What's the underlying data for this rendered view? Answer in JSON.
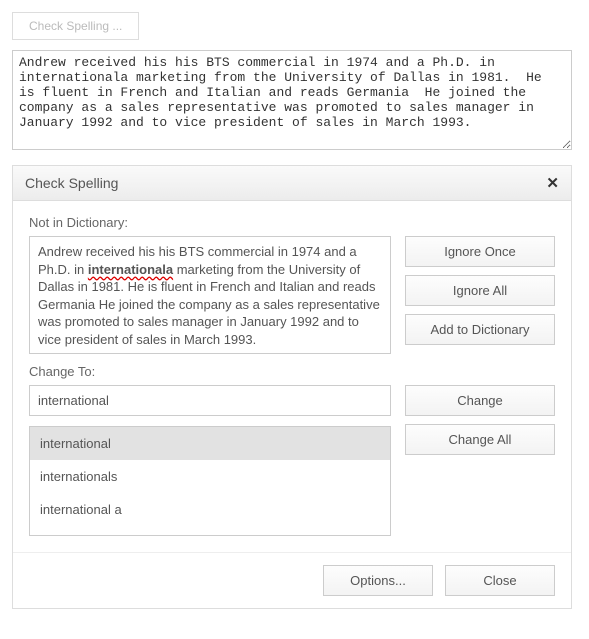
{
  "top_button": "Check Spelling ...",
  "textarea_value": "Andrew received his his BTS commercial in 1974 and a Ph.D. in internationala marketing from the University of Dallas in 1981.  He is fluent in French and Italian and reads Germania  He joined the company as a sales representative was promoted to sales manager in January 1992 and to vice president of sales in March 1993.",
  "dialog": {
    "title": "Check Spelling",
    "not_in_dict_label": "Not in Dictionary:",
    "context_before": "Andrew received his his BTS commercial in 1974 and a Ph.D. in ",
    "context_misspelled": "internationala",
    "context_after": " marketing from the University of Dallas in 1981. He is fluent in French and Italian and reads Germania He joined the company as a sales representative was promoted to sales manager in January 1992 and to vice president of sales in March 1993.",
    "change_to_label": "Change To:",
    "change_to_value": "international",
    "suggestions": [
      "international",
      "internationals",
      "international a"
    ],
    "buttons": {
      "ignore_once": "Ignore Once",
      "ignore_all": "Ignore All",
      "add_to_dict": "Add to Dictionary",
      "change": "Change",
      "change_all": "Change All",
      "options": "Options...",
      "close": "Close"
    }
  }
}
